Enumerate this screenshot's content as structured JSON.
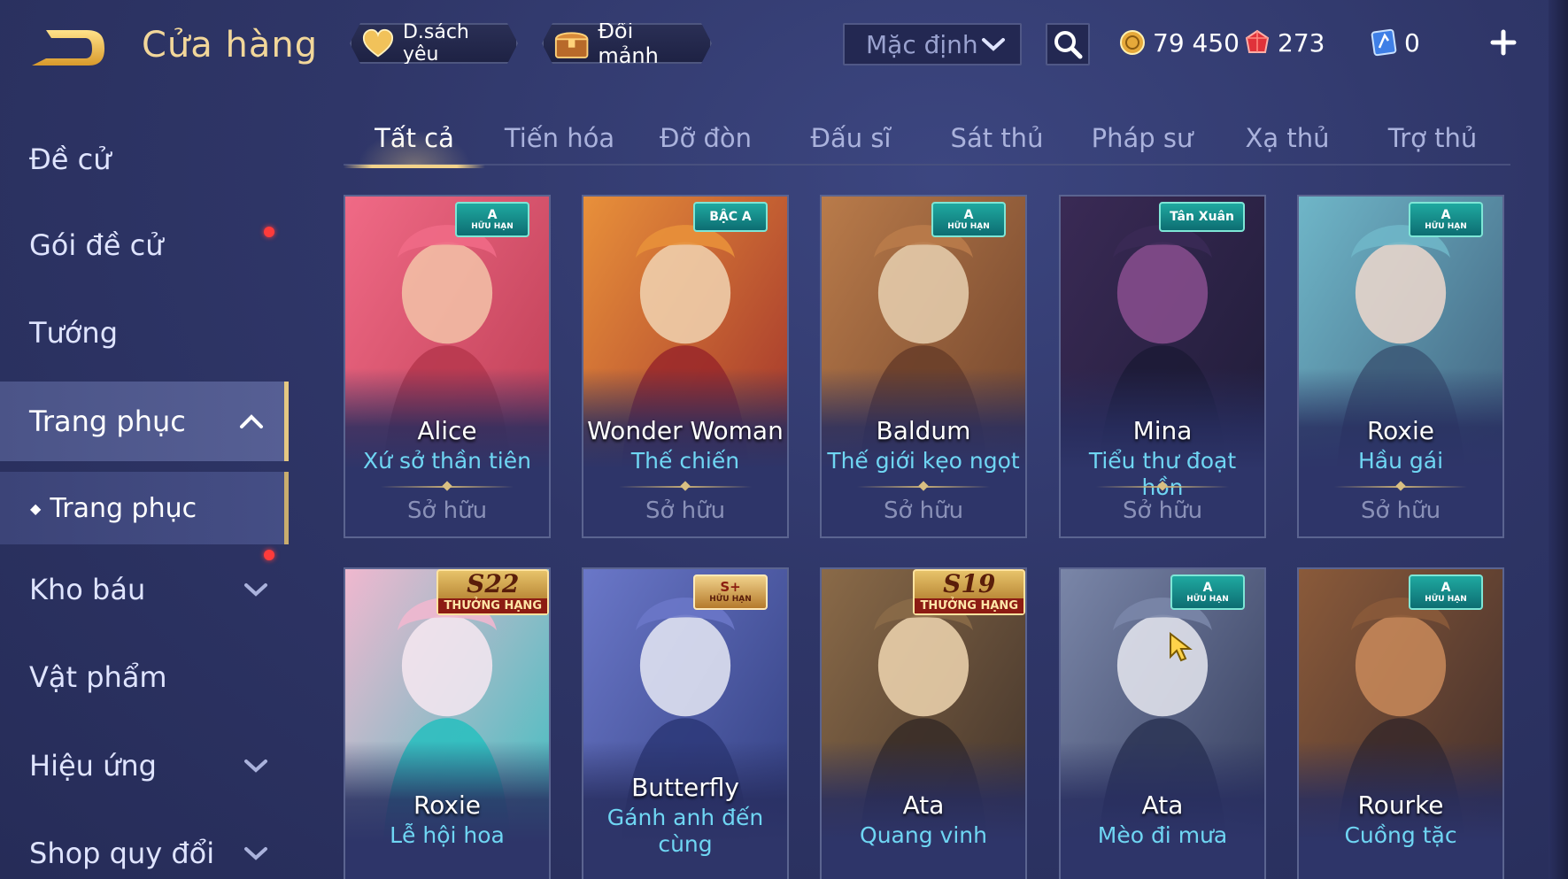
{
  "header": {
    "title": "Cửa hàng",
    "favorites_label": "D.sách yêu",
    "exchange_label": "Đổi mảnh",
    "sort_value": "Mặc định"
  },
  "currencies": {
    "gold": "79 450",
    "voucher": "273",
    "ticket": "0"
  },
  "sidebar": {
    "items": [
      {
        "label": "Đề cử"
      },
      {
        "label": "Gói đề cử"
      },
      {
        "label": "Tướng"
      },
      {
        "label": "Trang phục"
      },
      {
        "label": "Trang phục"
      },
      {
        "label": "Kho báu"
      },
      {
        "label": "Vật phẩm"
      },
      {
        "label": "Hiệu ứng"
      },
      {
        "label": "Shop quy đổi"
      }
    ]
  },
  "tabs": [
    {
      "label": "Tất cả"
    },
    {
      "label": "Tiến hóa"
    },
    {
      "label": "Đỡ đòn"
    },
    {
      "label": "Đấu sĩ"
    },
    {
      "label": "Sát thủ"
    },
    {
      "label": "Pháp sư"
    },
    {
      "label": "Xạ thủ"
    },
    {
      "label": "Trợ thủ"
    }
  ],
  "cards": [
    {
      "hero": "Alice",
      "skin": "Xứ sở thần tiên",
      "status": "Sở hữu",
      "badge_top": "A",
      "badge_bottom": "HỮU HẠN",
      "colors": [
        "#f06a86",
        "#b8394f",
        "#f3c3a8"
      ]
    },
    {
      "hero": "Wonder Woman",
      "skin": "Thế chiến",
      "status": "Sở hữu",
      "badge_top": "BẬC A",
      "badge_bottom": "",
      "colors": [
        "#e8903a",
        "#9b2a2a",
        "#f1d4b2"
      ]
    },
    {
      "hero": "Baldum",
      "skin": "Thế giới kẹo ngọt",
      "status": "Sở hữu",
      "badge_top": "A",
      "badge_bottom": "HỮU HẠN",
      "colors": [
        "#b97b4a",
        "#6a3f2a",
        "#e8d0b0"
      ]
    },
    {
      "hero": "Mina",
      "skin": "Tiểu thư đoạt hồn",
      "status": "Sở hữu",
      "badge_top": "Tân Xuân",
      "badge_bottom": "",
      "colors": [
        "#3a2a55",
        "#1d1b36",
        "#8a4f8f"
      ]
    },
    {
      "hero": "Roxie",
      "skin": "Hầu gái",
      "status": "Sở hữu",
      "badge_top": "A",
      "badge_bottom": "HỮU HẠN",
      "colors": [
        "#6fb6c8",
        "#3d5a78",
        "#eed8cc"
      ]
    },
    {
      "hero": "Roxie",
      "skin": "Lễ hội hoa",
      "status": "",
      "badge_top": "S22",
      "badge_bottom": "THƯỞNG HẠNG",
      "colors": [
        "#f0b8cf",
        "#2cbfbf",
        "#f7e7f1"
      ]
    },
    {
      "hero": "Butterfly",
      "skin": "Gánh anh đến cùng",
      "status": "",
      "badge_top": "S+",
      "badge_bottom": "HỮU HẠN",
      "colors": [
        "#6a77c8",
        "#2d3a7a",
        "#e6e9f5"
      ]
    },
    {
      "hero": "Ata",
      "skin": "Quang vinh",
      "status": "",
      "badge_top": "S19",
      "badge_bottom": "THƯỞNG HẠNG",
      "colors": [
        "#8a6a48",
        "#3a2e28",
        "#f0d6b0"
      ]
    },
    {
      "hero": "Ata",
      "skin": "Mèo đi mưa",
      "status": "",
      "badge_top": "A",
      "badge_bottom": "HỮU HẠN",
      "colors": [
        "#7a86a8",
        "#2e3656",
        "#e6e8f0"
      ]
    },
    {
      "hero": "Rourke",
      "skin": "Cuồng tặc",
      "status": "",
      "badge_top": "A",
      "badge_bottom": "HỮU HẠN",
      "colors": [
        "#8a5a3a",
        "#3a2a2a",
        "#c98a5a"
      ]
    }
  ]
}
